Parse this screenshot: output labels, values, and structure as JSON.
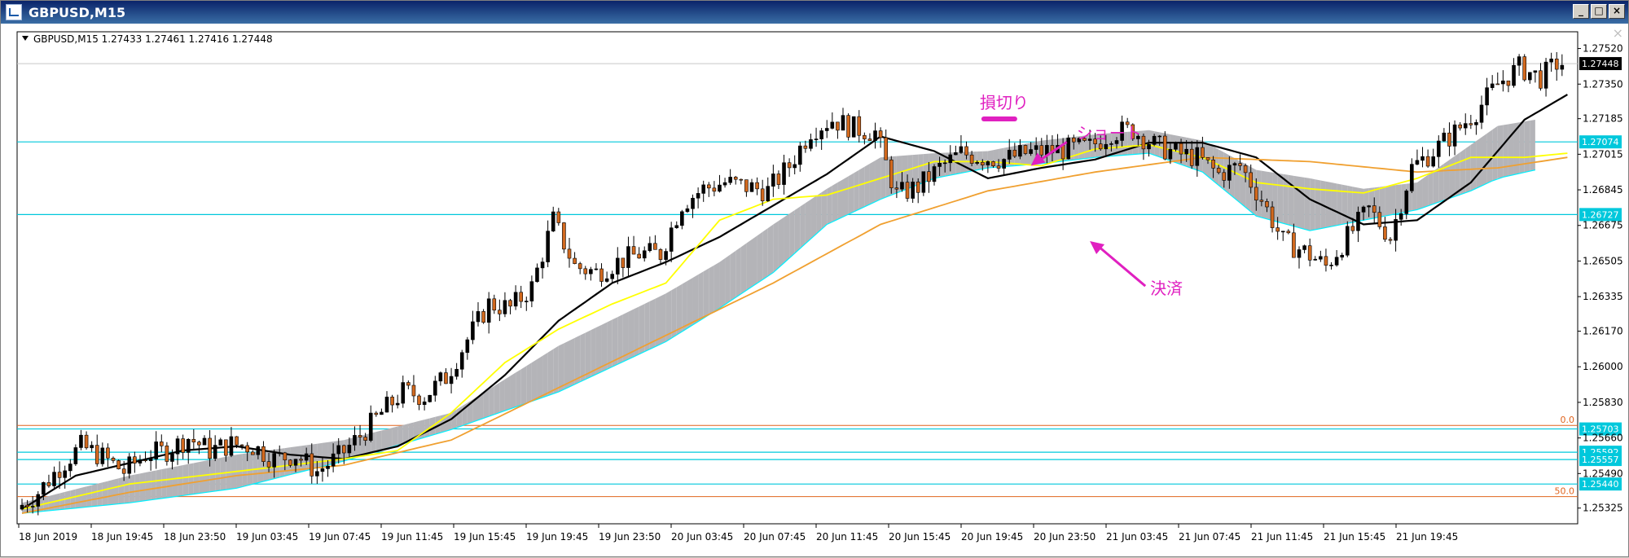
{
  "window": {
    "title": "GBPUSD,M15",
    "buttons": [
      "minimize",
      "maximize",
      "close"
    ]
  },
  "header": {
    "symbol_info": "GBPUSD,M15  1.27433 1.27461 1.27416 1.27448"
  },
  "colors": {
    "candle_up": "#000000",
    "candle_down": "#d2691e",
    "cloud_gray": "#b4b4b8",
    "cloud_cyan": "#00f0ff",
    "sma_black": "#000000",
    "ma_orange": "#f0a030",
    "line_yellow": "#ffff00",
    "hline_cyan": "#00c8dc",
    "fib_orange": "#e0641e",
    "annotation_magenta": "#e020c0"
  },
  "chart_data": {
    "type": "candlestick",
    "symbol": "GBPUSD",
    "timeframe": "M15",
    "current_price": 1.27448,
    "ylim": [
      1.2525,
      1.276
    ],
    "y_ticks": [
      {
        "value": 1.2752,
        "label": "1.27520"
      },
      {
        "value": 1.2735,
        "label": "1.27350"
      },
      {
        "value": 1.27185,
        "label": "1.27185"
      },
      {
        "value": 1.27015,
        "label": "1.27015"
      },
      {
        "value": 1.26845,
        "label": "1.26845"
      },
      {
        "value": 1.26675,
        "label": "1.26675"
      },
      {
        "value": 1.26505,
        "label": "1.26505"
      },
      {
        "value": 1.26335,
        "label": "1.26335"
      },
      {
        "value": 1.2617,
        "label": "1.26170"
      },
      {
        "value": 1.26,
        "label": "1.26000"
      },
      {
        "value": 1.2583,
        "label": "1.25830"
      },
      {
        "value": 1.2566,
        "label": "1.25660"
      },
      {
        "value": 1.2549,
        "label": "1.25490"
      },
      {
        "value": 1.25325,
        "label": "1.25325"
      }
    ],
    "x_ticks": [
      "18 Jun 2019",
      "18 Jun 19:45",
      "18 Jun 23:50",
      "19 Jun 03:45",
      "19 Jun 07:45",
      "19 Jun 11:45",
      "19 Jun 15:45",
      "19 Jun 19:45",
      "19 Jun 23:50",
      "20 Jun 03:45",
      "20 Jun 07:45",
      "20 Jun 11:45",
      "20 Jun 15:45",
      "20 Jun 19:45",
      "20 Jun 23:50",
      "21 Jun 03:45",
      "21 Jun 07:45",
      "21 Jun 11:45",
      "21 Jun 15:45",
      "21 Jun 19:45"
    ],
    "horizontal_lines": [
      {
        "value": 1.27074,
        "label": "1.27074",
        "color": "#00c8dc"
      },
      {
        "value": 1.26727,
        "label": "1.26727",
        "color": "#00c8dc"
      },
      {
        "value": 1.25703,
        "label": "1.25703",
        "color": "#00c8dc"
      },
      {
        "value": 1.25592,
        "label": "1.25592",
        "color": "#00c8dc"
      },
      {
        "value": 1.25557,
        "label": "1.25557",
        "color": "#00c8dc"
      },
      {
        "value": 1.2544,
        "label": "1.25440",
        "color": "#00c8dc"
      }
    ],
    "fib_levels": [
      {
        "label": "0.0",
        "value": 1.2572
      },
      {
        "label": "50.0",
        "value": 1.2538
      }
    ],
    "annotations": [
      {
        "text": "損切り",
        "price": 1.2718,
        "bar": 180
      },
      {
        "text": "ショート",
        "price": 1.2705,
        "bar": 195
      },
      {
        "text": "決済",
        "price": 1.2637,
        "bar": 206
      }
    ],
    "close_path": [
      [
        0,
        1.2532
      ],
      [
        4,
        1.254
      ],
      [
        8,
        1.2552
      ],
      [
        12,
        1.2562
      ],
      [
        16,
        1.2557
      ],
      [
        20,
        1.255
      ],
      [
        24,
        1.2558
      ],
      [
        28,
        1.256
      ],
      [
        32,
        1.2566
      ],
      [
        36,
        1.256
      ],
      [
        40,
        1.2563
      ],
      [
        44,
        1.2562
      ],
      [
        48,
        1.2556
      ],
      [
        52,
        1.2558
      ],
      [
        56,
        1.255
      ],
      [
        60,
        1.2557
      ],
      [
        64,
        1.2567
      ],
      [
        68,
        1.2578
      ],
      [
        72,
        1.2588
      ],
      [
        76,
        1.2586
      ],
      [
        80,
        1.2595
      ],
      [
        84,
        1.2613
      ],
      [
        88,
        1.263
      ],
      [
        92,
        1.2628
      ],
      [
        96,
        1.2638
      ],
      [
        100,
        1.267
      ],
      [
        104,
        1.2648
      ],
      [
        108,
        1.2645
      ],
      [
        112,
        1.265
      ],
      [
        116,
        1.2654
      ],
      [
        120,
        1.2654
      ],
      [
        124,
        1.2678
      ],
      [
        128,
        1.2685
      ],
      [
        132,
        1.2688
      ],
      [
        136,
        1.2686
      ],
      [
        140,
        1.2684
      ],
      [
        144,
        1.2696
      ],
      [
        148,
        1.2713
      ],
      [
        152,
        1.2718
      ],
      [
        156,
        1.2714
      ],
      [
        160,
        1.2712
      ],
      [
        164,
        1.2682
      ],
      [
        168,
        1.2686
      ],
      [
        172,
        1.2695
      ],
      [
        176,
        1.2702
      ],
      [
        180,
        1.27
      ],
      [
        184,
        1.2699
      ],
      [
        188,
        1.2702
      ],
      [
        192,
        1.2703
      ],
      [
        196,
        1.2704
      ],
      [
        200,
        1.2705
      ],
      [
        204,
        1.2712
      ],
      [
        208,
        1.2713
      ],
      [
        212,
        1.2706
      ],
      [
        216,
        1.2702
      ],
      [
        220,
        1.27
      ],
      [
        224,
        1.2692
      ],
      [
        228,
        1.2696
      ],
      [
        232,
        1.268
      ],
      [
        236,
        1.266
      ],
      [
        240,
        1.2655
      ],
      [
        244,
        1.2648
      ],
      [
        248,
        1.2662
      ],
      [
        252,
        1.2675
      ],
      [
        256,
        1.2662
      ],
      [
        260,
        1.2695
      ],
      [
        264,
        1.2703
      ],
      [
        268,
        1.2712
      ],
      [
        272,
        1.2722
      ],
      [
        276,
        1.2735
      ],
      [
        280,
        1.2743
      ],
      [
        284,
        1.2738
      ],
      [
        287,
        1.27448
      ]
    ],
    "series": [
      {
        "type": "line",
        "color": "#000000",
        "points": [
          [
            0,
            1.2532
          ],
          [
            10,
            1.2548
          ],
          [
            20,
            1.2554
          ],
          [
            30,
            1.256
          ],
          [
            40,
            1.2562
          ],
          [
            50,
            1.2558
          ],
          [
            60,
            1.2556
          ],
          [
            70,
            1.2562
          ],
          [
            80,
            1.2575
          ],
          [
            90,
            1.2596
          ],
          [
            100,
            1.2622
          ],
          [
            110,
            1.264
          ],
          [
            120,
            1.265
          ],
          [
            130,
            1.2662
          ],
          [
            140,
            1.2677
          ],
          [
            150,
            1.2692
          ],
          [
            160,
            1.271
          ],
          [
            170,
            1.2703
          ],
          [
            180,
            1.269
          ],
          [
            190,
            1.2695
          ],
          [
            200,
            1.2699
          ],
          [
            210,
            1.2707
          ],
          [
            220,
            1.2707
          ],
          [
            230,
            1.27
          ],
          [
            240,
            1.268
          ],
          [
            250,
            1.2668
          ],
          [
            260,
            1.267
          ],
          [
            270,
            1.2688
          ],
          [
            280,
            1.2718
          ],
          [
            288,
            1.273
          ]
        ]
      },
      {
        "type": "line",
        "color": "#f0a030",
        "points": [
          [
            0,
            1.253
          ],
          [
            20,
            1.254
          ],
          [
            40,
            1.2548
          ],
          [
            60,
            1.2553
          ],
          [
            80,
            1.2565
          ],
          [
            100,
            1.259
          ],
          [
            120,
            1.2615
          ],
          [
            140,
            1.264
          ],
          [
            160,
            1.2668
          ],
          [
            180,
            1.2684
          ],
          [
            200,
            1.2693
          ],
          [
            220,
            1.27
          ],
          [
            240,
            1.2698
          ],
          [
            260,
            1.2693
          ],
          [
            275,
            1.2695
          ],
          [
            288,
            1.27
          ]
        ]
      },
      {
        "type": "line",
        "color": "#ffff00",
        "points": [
          [
            0,
            1.2532
          ],
          [
            20,
            1.2544
          ],
          [
            40,
            1.255
          ],
          [
            60,
            1.2556
          ],
          [
            70,
            1.256
          ],
          [
            80,
            1.2578
          ],
          [
            90,
            1.2602
          ],
          [
            100,
            1.2618
          ],
          [
            110,
            1.263
          ],
          [
            120,
            1.264
          ],
          [
            130,
            1.267
          ],
          [
            140,
            1.268
          ],
          [
            150,
            1.2682
          ],
          [
            160,
            1.269
          ],
          [
            170,
            1.2698
          ],
          [
            180,
            1.2698
          ],
          [
            190,
            1.2696
          ],
          [
            200,
            1.2704
          ],
          [
            210,
            1.2706
          ],
          [
            220,
            1.27
          ],
          [
            230,
            1.2688
          ],
          [
            240,
            1.2685
          ],
          [
            250,
            1.2683
          ],
          [
            260,
            1.269
          ],
          [
            270,
            1.27
          ],
          [
            280,
            1.27
          ],
          [
            288,
            1.2702
          ]
        ]
      }
    ],
    "cloud": {
      "upper": [
        [
          0,
          1.2535
        ],
        [
          20,
          1.2548
        ],
        [
          40,
          1.2558
        ],
        [
          60,
          1.2565
        ],
        [
          80,
          1.2578
        ],
        [
          100,
          1.261
        ],
        [
          120,
          1.2635
        ],
        [
          130,
          1.265
        ],
        [
          140,
          1.2668
        ],
        [
          150,
          1.2685
        ],
        [
          160,
          1.27
        ],
        [
          170,
          1.2702
        ],
        [
          180,
          1.2703
        ],
        [
          190,
          1.2708
        ],
        [
          200,
          1.2711
        ],
        [
          210,
          1.2713
        ],
        [
          220,
          1.2708
        ],
        [
          230,
          1.2694
        ],
        [
          240,
          1.269
        ],
        [
          250,
          1.2685
        ],
        [
          260,
          1.2688
        ],
        [
          270,
          1.2706
        ],
        [
          275,
          1.2715
        ],
        [
          282,
          1.2718
        ]
      ],
      "lower": [
        [
          0,
          1.253
        ],
        [
          20,
          1.2535
        ],
        [
          40,
          1.2542
        ],
        [
          60,
          1.2555
        ],
        [
          80,
          1.257
        ],
        [
          100,
          1.2588
        ],
        [
          120,
          1.2612
        ],
        [
          130,
          1.2628
        ],
        [
          140,
          1.2645
        ],
        [
          150,
          1.2668
        ],
        [
          160,
          1.268
        ],
        [
          170,
          1.269
        ],
        [
          180,
          1.2695
        ],
        [
          190,
          1.2697
        ],
        [
          200,
          1.27
        ],
        [
          210,
          1.2702
        ],
        [
          220,
          1.2693
        ],
        [
          230,
          1.2672
        ],
        [
          240,
          1.2665
        ],
        [
          250,
          1.267
        ],
        [
          260,
          1.2675
        ],
        [
          270,
          1.2684
        ],
        [
          275,
          1.269
        ],
        [
          282,
          1.2694
        ]
      ]
    }
  }
}
